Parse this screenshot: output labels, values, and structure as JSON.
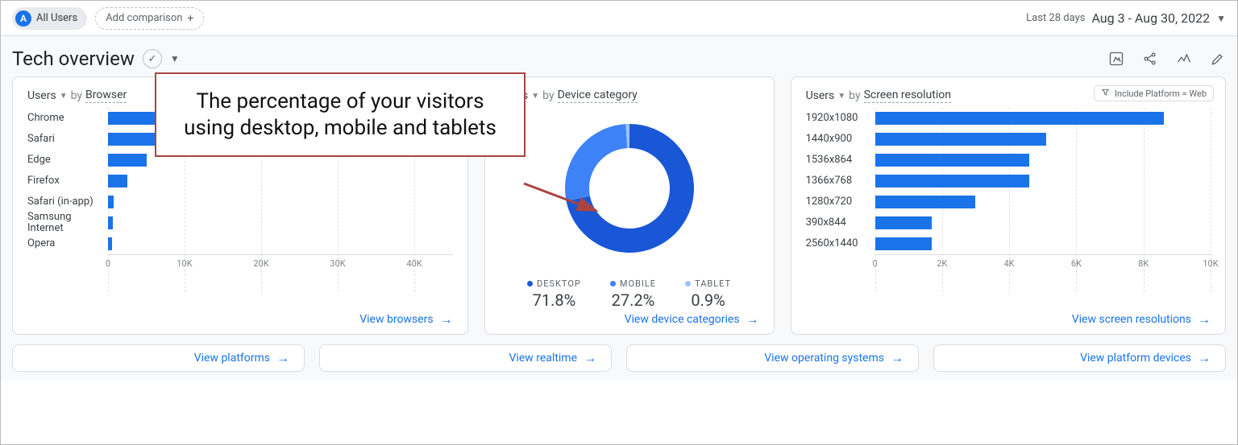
{
  "topbar": {
    "chip_letter": "A",
    "chip_label": "All Users",
    "add_comparison_label": "Add comparison",
    "date_info": "Last 28 days",
    "date_range": "Aug 3 - Aug 30, 2022"
  },
  "header": {
    "title": "Tech overview"
  },
  "annotation": {
    "text": "The percentage of your visitors using desktop, mobile and tablets"
  },
  "card_browser": {
    "metric": "Users",
    "by": "by",
    "dimension": "Browser",
    "view_label": "View browsers"
  },
  "card_device": {
    "metric": "Users",
    "by": "by",
    "dimension": "Device category",
    "view_label": "View device categories",
    "legend": [
      {
        "label": "DESKTOP",
        "value": "71.8%"
      },
      {
        "label": "MOBILE",
        "value": "27.2%"
      },
      {
        "label": "TABLET",
        "value": "0.9%"
      }
    ]
  },
  "card_resolution": {
    "metric": "Users",
    "by": "by",
    "dimension": "Screen resolution",
    "include_chip": "Include Platform = Web",
    "view_label": "View screen resolutions"
  },
  "bottom": {
    "platforms": "View platforms",
    "realtime": "View realtime",
    "os": "View operating systems",
    "platform_devices": "View platform devices"
  },
  "chart_data": [
    {
      "id": "browser",
      "type": "bar",
      "orientation": "horizontal",
      "title": "Users by Browser",
      "xlabel": "",
      "ylabel": "",
      "xlim": [
        0,
        45000
      ],
      "x_ticks": [
        0,
        10000,
        20000,
        30000,
        40000
      ],
      "x_tick_labels": [
        "0",
        "10K",
        "20K",
        "30K",
        "40K"
      ],
      "categories": [
        "Chrome",
        "Safari",
        "Edge",
        "Firefox",
        "Safari (in-app)",
        "Samsung Internet",
        "Opera"
      ],
      "values": [
        42000,
        14000,
        5000,
        2500,
        700,
        600,
        500
      ]
    },
    {
      "id": "device",
      "type": "pie",
      "variant": "donut",
      "title": "Users by Device category",
      "categories": [
        "Desktop",
        "Mobile",
        "Tablet"
      ],
      "values": [
        71.8,
        27.2,
        0.9
      ],
      "colors": [
        "#1a57d6",
        "#3e82f7",
        "#9cc2ff"
      ]
    },
    {
      "id": "resolution",
      "type": "bar",
      "orientation": "horizontal",
      "title": "Users by Screen resolution",
      "xlabel": "",
      "ylabel": "",
      "xlim": [
        0,
        10000
      ],
      "x_ticks": [
        0,
        2000,
        4000,
        6000,
        8000,
        10000
      ],
      "x_tick_labels": [
        "0",
        "2K",
        "4K",
        "6K",
        "8K",
        "10K"
      ],
      "categories": [
        "1920x1080",
        "1440x900",
        "1536x864",
        "1366x768",
        "1280x720",
        "390x844",
        "2560x1440"
      ],
      "values": [
        8600,
        5100,
        4600,
        4600,
        3000,
        1700,
        1700
      ]
    }
  ]
}
